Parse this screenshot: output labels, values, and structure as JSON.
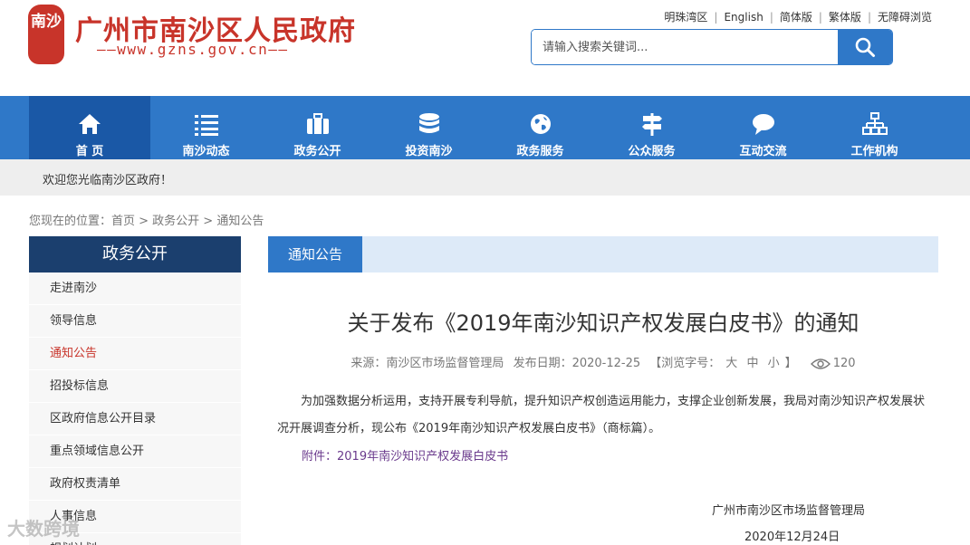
{
  "header": {
    "seal_text": "南沙",
    "title": "广州市南沙区人民政府",
    "url": "——www.gzns.gov.cn——",
    "top_links": [
      "明珠湾区",
      "English",
      "简体版",
      "繁体版",
      "无障碍浏览"
    ],
    "search_placeholder": "请输入搜索关键词..."
  },
  "nav": {
    "items": [
      {
        "label": "首 页",
        "icon": "home-icon"
      },
      {
        "label": "南沙动态",
        "icon": "list-icon"
      },
      {
        "label": "政务公开",
        "icon": "briefcase-icon"
      },
      {
        "label": "投资南沙",
        "icon": "database-icon"
      },
      {
        "label": "政务服务",
        "icon": "globe-icon"
      },
      {
        "label": "公众服务",
        "icon": "signpost-icon"
      },
      {
        "label": "互动交流",
        "icon": "chat-icon"
      },
      {
        "label": "工作机构",
        "icon": "org-chart-icon"
      }
    ]
  },
  "welcome": "欢迎您光临南沙区政府！",
  "breadcrumb": "您现在的位置：首页 > 政务公开 > 通知公告",
  "sidebar": {
    "title": "政务公开",
    "items": [
      "走进南沙",
      "领导信息",
      "通知公告",
      "招投标信息",
      "区政府信息公开目录",
      "重点领域信息公开",
      "政府权责清单",
      "人事信息",
      "规划计划"
    ]
  },
  "tab": "通知公告",
  "article": {
    "title": "关于发布《2019年南沙知识产权发展白皮书》的通知",
    "source": "来源：南沙区市场监督管理局",
    "date": "发布日期：2020-12-25",
    "font_size_label": "【浏览字号：",
    "size_large": "大",
    "size_medium": "中",
    "size_small": "小",
    "font_size_end": "】",
    "views": "120",
    "body": "为加强数据分析运用，支持开展专利导航，提升知识产权创造运用能力，支撑企业创新发展，我局对南沙知识产权发展状况开展调查分析，现公布《2019年南沙知识产权发展白皮书》（商标篇）。",
    "attachment": "附件：2019年南沙知识产权发展白皮书",
    "sign_org": "广州市南沙区市场监督管理局",
    "sign_date": "2020年12月24日"
  },
  "watermark": "大数跨境",
  "colors": {
    "brand_red": "#c8342a",
    "nav_blue": "#2f78c8",
    "nav_active": "#1a58a6",
    "sidebar_head": "#1b3f6e"
  }
}
